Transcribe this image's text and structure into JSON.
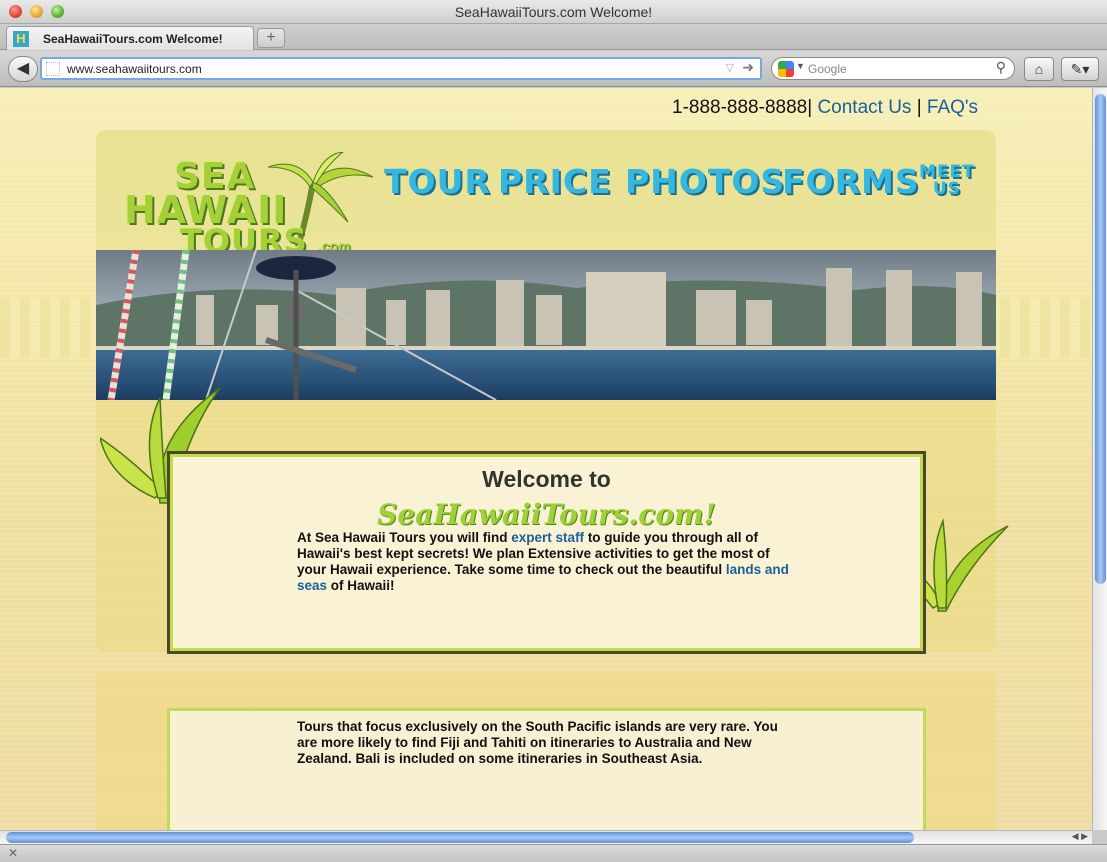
{
  "window": {
    "title": "SeaHawaiiTours.com Welcome!"
  },
  "tabs": [
    {
      "label": "SeaHawaiiTours.com Welcome!",
      "favicon": "H"
    }
  ],
  "toolbar": {
    "new_tab": "+",
    "back": "◀",
    "url": "www.seahawaiitours.com",
    "search_placeholder": "Google",
    "home": "⌂",
    "bookmarks": "✎▾"
  },
  "site": {
    "phone": "1-888-888-8888",
    "separator": "|",
    "contact": "Contact Us",
    "faq": "FAQ's",
    "logo": {
      "line1": "SEA",
      "line2": "HAWAII",
      "line3": "TOURS",
      "suffix": ".com"
    },
    "nav": [
      {
        "label": "TOUR"
      },
      {
        "label": "PRICE"
      },
      {
        "label": "PHOTOS"
      },
      {
        "label": "FORMS"
      },
      {
        "label": "MEET US",
        "line1": "MEET",
        "line2": "US"
      }
    ],
    "welcome": {
      "heading": "Welcome to",
      "site_name": "SeaHawaiiTours.com!",
      "text_1": "At Sea Hawaii Tours you will find ",
      "link_1": "expert staff",
      "text_2": " to guide you through all of Hawaii's best kept secrets! We plan Extensive activities to get the most of your Hawaii experience. Take some time to check out the beautiful ",
      "link_2": "lands and seas",
      "text_3": " of Hawaii!"
    },
    "paragraph_2": "Tours that focus exclusively on the South Pacific islands are very rare. You are more likely to find Fiji and Tahiti on itineraries to Australia and New Zealand. Bali is included on some itineraries in Southeast Asia."
  },
  "colors": {
    "nav": "#36b7df",
    "logo": "#a6cf3a",
    "link": "#1b5f9a",
    "background": "#f3e6a6"
  }
}
